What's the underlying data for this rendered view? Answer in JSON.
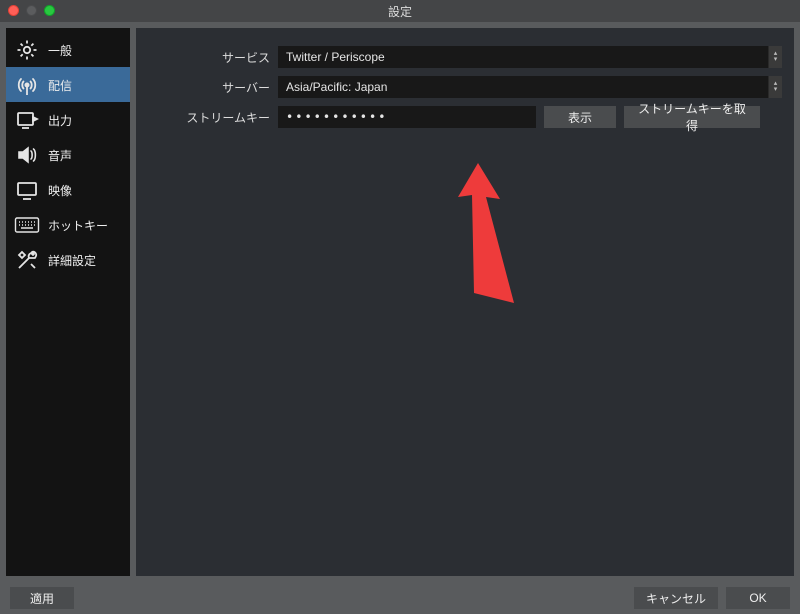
{
  "title": "設定",
  "sidebar": {
    "items": [
      {
        "label": "一般"
      },
      {
        "label": "配信"
      },
      {
        "label": "出力"
      },
      {
        "label": "音声"
      },
      {
        "label": "映像"
      },
      {
        "label": "ホットキー"
      },
      {
        "label": "詳細設定"
      }
    ]
  },
  "form": {
    "service_label": "サービス",
    "service_value": "Twitter / Periscope",
    "server_label": "サーバー",
    "server_value": "Asia/Pacific: Japan",
    "streamkey_label": "ストリームキー",
    "streamkey_value": "•••••••••••",
    "show_btn": "表示",
    "getkey_btn": "ストリームキーを取得"
  },
  "footer": {
    "apply": "適用",
    "cancel": "キャンセル",
    "ok": "OK"
  }
}
